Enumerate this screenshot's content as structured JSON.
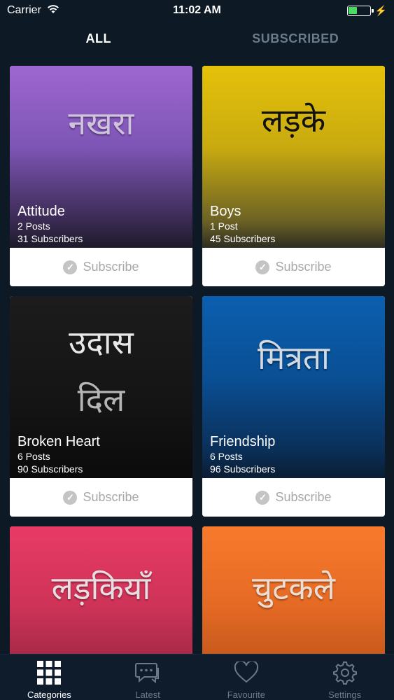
{
  "status": {
    "carrier": "Carrier",
    "time": "11:02 AM"
  },
  "tabs": [
    {
      "label": "ALL",
      "active": true
    },
    {
      "label": "SUBSCRIBED",
      "active": false
    }
  ],
  "cards": [
    {
      "hindi": "नखरा",
      "name": "Attitude",
      "posts": "2 Posts",
      "subscribers": "31 Subscribers",
      "action": "Subscribe"
    },
    {
      "hindi": "लड़के",
      "name": "Boys",
      "posts": "1 Post",
      "subscribers": "45 Subscribers",
      "action": "Subscribe"
    },
    {
      "hindi_line1": "उदास",
      "hindi_line2": "दिल",
      "name": "Broken Heart",
      "posts": "6 Posts",
      "subscribers": "90 Subscribers",
      "action": "Subscribe"
    },
    {
      "hindi": "मित्रता",
      "name": "Friendship",
      "posts": "6 Posts",
      "subscribers": "96 Subscribers",
      "action": "Subscribe"
    },
    {
      "hindi": "लड़कियाँ"
    },
    {
      "hindi": "चुटकले"
    }
  ],
  "tab_bar": [
    {
      "label": "Categories",
      "icon": "grid-icon",
      "selected": true
    },
    {
      "label": "Latest",
      "icon": "chat-icon",
      "selected": false
    },
    {
      "label": "Favourite",
      "icon": "heart-icon",
      "selected": false
    },
    {
      "label": "Settings",
      "icon": "gear-icon",
      "selected": false
    }
  ],
  "colors": {
    "background": "#0d1a26",
    "tab_inactive": "#6b7a88",
    "subscribe_text": "#a8a8a8",
    "battery": "#4cd964"
  }
}
